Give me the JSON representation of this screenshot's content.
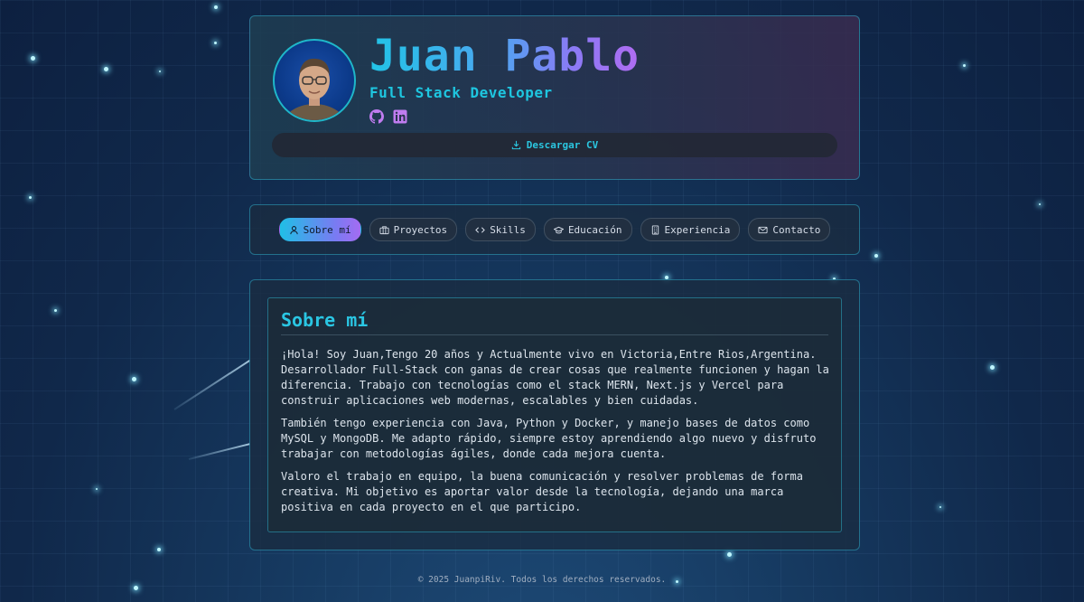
{
  "header": {
    "name": "Juan Pablo",
    "role": "Full Stack Developer",
    "socials": [
      "github-icon",
      "linkedin-icon"
    ],
    "cv_label": "Descargar CV"
  },
  "nav": {
    "items": [
      {
        "label": "Sobre mí",
        "icon": "user-icon",
        "active": true
      },
      {
        "label": "Proyectos",
        "icon": "briefcase-icon",
        "active": false
      },
      {
        "label": "Skills",
        "icon": "code-icon",
        "active": false
      },
      {
        "label": "Educación",
        "icon": "graduation-cap-icon",
        "active": false
      },
      {
        "label": "Experiencia",
        "icon": "building-icon",
        "active": false
      },
      {
        "label": "Contacto",
        "icon": "mail-icon",
        "active": false
      }
    ]
  },
  "about": {
    "title": "Sobre mí",
    "paragraphs": [
      "¡Hola! Soy Juan,Tengo 20 años y Actualmente vivo en Victoria,Entre Rios,Argentina. Desarrollador Full-Stack con ganas de crear cosas que realmente funcionen y hagan la diferencia. Trabajo con tecnologías como el stack MERN, Next.js y Vercel para construir aplicaciones web modernas, escalables y bien cuidadas.",
      "También tengo experiencia con Java, Python y Docker, y manejo bases de datos como MySQL y MongoDB. Me adapto rápido, siempre estoy aprendiendo algo nuevo y disfruto trabajar con metodologías ágiles, donde cada mejora cuenta.",
      "Valoro el trabajo en equipo, la buena comunicación y resolver problemas de forma creativa. Mi objetivo es aportar valor desde la tecnología, dejando una marca positiva en cada proyecto en el que participo."
    ]
  },
  "footer": {
    "text": "© 2025 JuanpiRiv. Todos los derechos reservados."
  },
  "colors": {
    "accent": "#1ec6e0",
    "gradient_end": "#b06cf2",
    "background": "#163a61"
  }
}
